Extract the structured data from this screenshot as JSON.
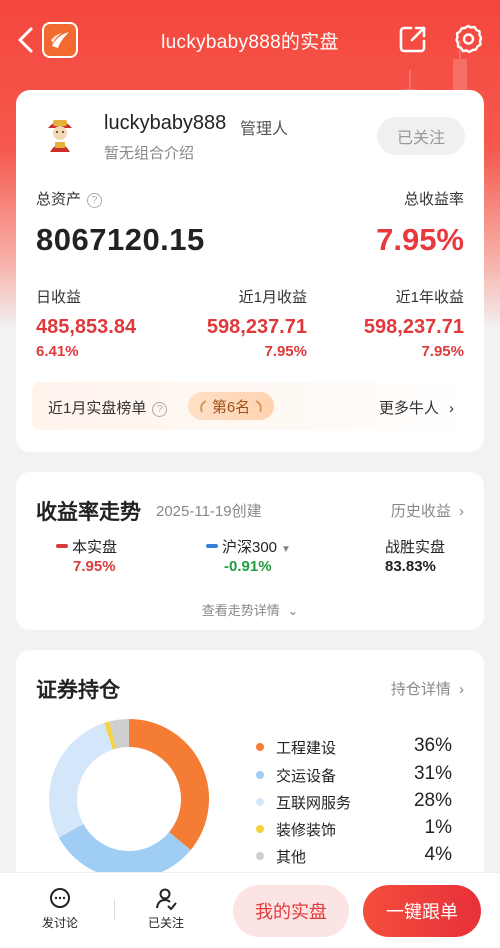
{
  "header": {
    "title": "luckybaby888的实盘",
    "icons": [
      "back-icon",
      "app-logo",
      "share-icon",
      "gear-icon"
    ]
  },
  "profile": {
    "username": "luckybaby888",
    "role": "管理人",
    "intro": "暂无组合介绍",
    "follow_label": "已关注"
  },
  "summary": {
    "total_assets_label": "总资产",
    "total_assets": "8067120.15",
    "total_rate_label": "总收益率",
    "total_rate": "7.95%",
    "stats": [
      {
        "label": "日收益",
        "value": "485,853.84",
        "pct": "6.41%"
      },
      {
        "label": "近1月收益",
        "value": "598,237.71",
        "pct": "7.95%"
      },
      {
        "label": "近1年收益",
        "value": "598,237.71",
        "pct": "7.95%"
      }
    ]
  },
  "ranking": {
    "label": "近1月实盘榜单",
    "badge": "第6名",
    "more": "更多牛人"
  },
  "trend": {
    "title": "收益率走势",
    "created": "2025-11-19创建",
    "history_link": "历史收益",
    "legend": [
      {
        "name": "本实盘",
        "value": "7.95%",
        "color": "#d93a3a"
      },
      {
        "name": "沪深300",
        "value": "-0.91%",
        "color": "#3b7fd8"
      },
      {
        "name": "战胜实盘",
        "value": "83.83%",
        "color": "#222222"
      }
    ],
    "detail_link": "查看走势详情"
  },
  "holdings": {
    "title": "证券持仓",
    "detail_link": "持仓详情",
    "items": [
      {
        "name": "工程建设",
        "pct": "36%",
        "value": 36,
        "color": "#f47c34"
      },
      {
        "name": "交运设备",
        "pct": "31%",
        "value": 31,
        "color": "#9fcdf4"
      },
      {
        "name": "互联网服务",
        "pct": "28%",
        "value": 28,
        "color": "#d4e7fa"
      },
      {
        "name": "装修装饰",
        "pct": "1%",
        "value": 1,
        "color": "#f6d23b"
      },
      {
        "name": "其他",
        "pct": "4%",
        "value": 4,
        "color": "#cfcfcf"
      }
    ]
  },
  "bottom": {
    "discuss": "发讨论",
    "followed": "已关注",
    "my_portfolio": "我的实盘",
    "one_click_follow": "一键跟单"
  }
}
